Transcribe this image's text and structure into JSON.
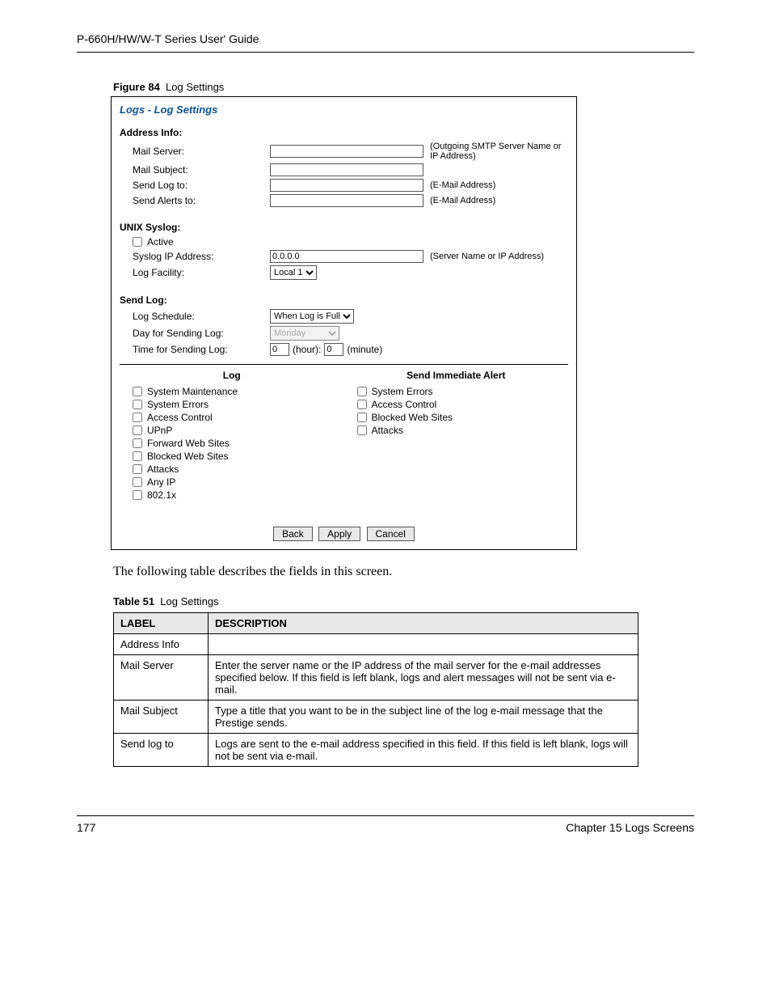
{
  "header": "P-660H/HW/W-T Series User' Guide",
  "figure": {
    "num": "Figure 84",
    "title": "Log Settings"
  },
  "panel": {
    "title": "Logs - Log Settings",
    "address_info": {
      "hdr": "Address Info:",
      "mail_server": {
        "label": "Mail Server:",
        "hint": "(Outgoing SMTP Server Name or IP Address)"
      },
      "mail_subject": {
        "label": "Mail Subject:"
      },
      "send_log_to": {
        "label": "Send Log to:",
        "hint": "(E-Mail Address)"
      },
      "send_alerts_to": {
        "label": "Send Alerts to:",
        "hint": "(E-Mail Address)"
      }
    },
    "unix_syslog": {
      "hdr": "UNIX Syslog:",
      "active": "Active",
      "syslog_ip": {
        "label": "Syslog IP Address:",
        "value": "0.0.0.0",
        "hint": "(Server Name or IP Address)"
      },
      "log_facility": {
        "label": "Log Facility:",
        "value": "Local 1"
      }
    },
    "send_log": {
      "hdr": "Send Log:",
      "schedule": {
        "label": "Log Schedule:",
        "value": "When Log is Full"
      },
      "day": {
        "label": "Day for Sending Log:",
        "value": "Monday"
      },
      "time": {
        "label": "Time for Sending Log:",
        "hour": "0",
        "hour_unit": "(hour):",
        "minute": "0",
        "minute_unit": "(minute)"
      }
    },
    "log_col": {
      "hdr": "Log",
      "items": [
        "System Maintenance",
        "System Errors",
        "Access Control",
        "UPnP",
        "Forward Web Sites",
        "Blocked Web Sites",
        "Attacks",
        "Any IP",
        "802.1x"
      ]
    },
    "alert_col": {
      "hdr": "Send Immediate Alert",
      "items": [
        "System Errors",
        "Access Control",
        "Blocked Web Sites",
        "Attacks"
      ]
    },
    "buttons": {
      "back": "Back",
      "apply": "Apply",
      "cancel": "Cancel"
    }
  },
  "body_text": "The following table describes the fields in this screen.",
  "table": {
    "num": "Table 51",
    "title": "Log Settings",
    "headers": {
      "label": "LABEL",
      "desc": "DESCRIPTION"
    },
    "rows": [
      {
        "label": "Address Info",
        "desc": ""
      },
      {
        "label": "Mail Server",
        "desc": "Enter the server name or the IP address of the mail server for the e-mail addresses specified below. If this field is left blank, logs and alert messages will not be sent via e-mail."
      },
      {
        "label": "Mail Subject",
        "desc": "Type a title that you want to be in the subject line of the log e-mail message that the Prestige sends."
      },
      {
        "label": "Send log to",
        "desc": "Logs are sent to the e-mail address specified in this field. If this field is left blank, logs will not be sent via e-mail."
      }
    ]
  },
  "footer": {
    "page": "177",
    "chapter": "Chapter 15 Logs Screens"
  }
}
